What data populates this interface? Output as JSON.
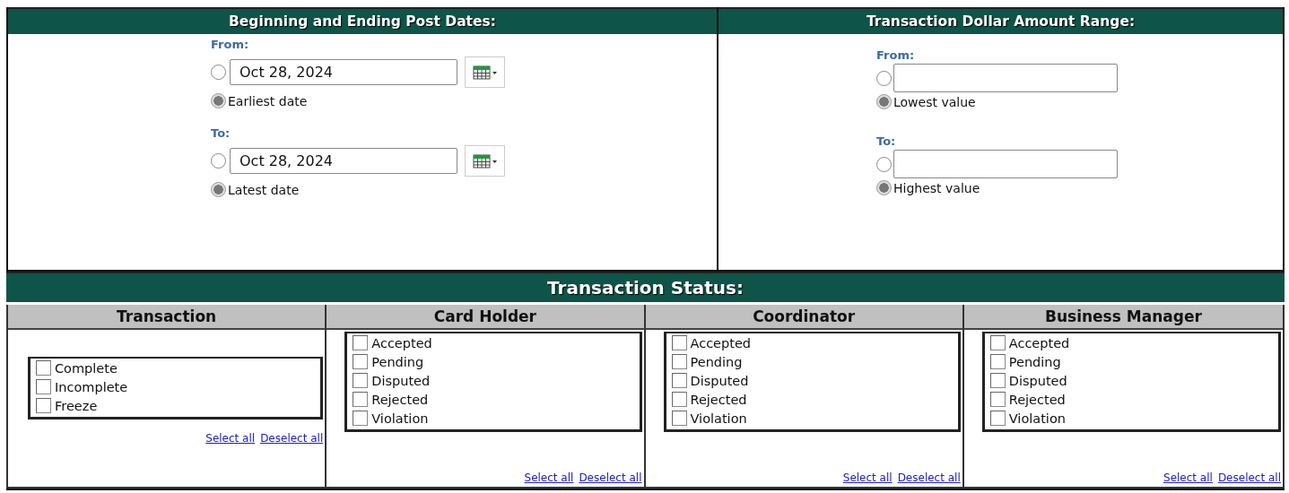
{
  "post_dates": {
    "title": "Beginning and Ending Post Dates:",
    "ranges": [
      {
        "label": "From:",
        "options": [
          {
            "kind": "date",
            "value": "Oct 28, 2024",
            "selected": false
          },
          {
            "kind": "default",
            "label": "Earliest date",
            "selected": true
          }
        ]
      },
      {
        "label": "To:",
        "options": [
          {
            "kind": "date",
            "value": "Oct 28, 2024",
            "selected": false
          },
          {
            "kind": "default",
            "label": "Latest date",
            "selected": true
          }
        ]
      }
    ]
  },
  "amount_range": {
    "title": "Transaction Dollar Amount Range:",
    "ranges": [
      {
        "label": "From:",
        "options": [
          {
            "kind": "amount",
            "selected": false
          },
          {
            "kind": "default",
            "label": "Lowest value",
            "selected": true
          }
        ]
      },
      {
        "label": "To:",
        "options": [
          {
            "kind": "amount",
            "selected": false
          },
          {
            "kind": "default",
            "label": "Highest value",
            "selected": true
          }
        ]
      }
    ]
  },
  "transaction_status": {
    "title": "Transaction Status:",
    "columns": [
      {
        "heading": "Transaction",
        "items": [
          {
            "label": "Complete",
            "checked": false
          },
          {
            "label": "Incomplete",
            "checked": false
          },
          {
            "label": "Freeze",
            "checked": false
          }
        ],
        "links": [
          "Select all",
          "Deselect all"
        ]
      },
      {
        "heading": "Card Holder",
        "items": [
          {
            "label": "Accepted",
            "checked": false
          },
          {
            "label": "Pending",
            "checked": false
          },
          {
            "label": "Disputed",
            "checked": false
          },
          {
            "label": "Rejected",
            "checked": false
          },
          {
            "label": "Violation",
            "checked": false
          }
        ],
        "links": [
          "Select all",
          "Deselect all"
        ]
      },
      {
        "heading": "Coordinator",
        "items": [
          {
            "label": "Accepted",
            "checked": false
          },
          {
            "label": "Pending",
            "checked": false
          },
          {
            "label": "Disputed",
            "checked": false
          },
          {
            "label": "Rejected",
            "checked": false
          },
          {
            "label": "Violation",
            "checked": false
          }
        ],
        "links": [
          "Select all",
          "Deselect all"
        ]
      },
      {
        "heading": "Business Manager",
        "items": [
          {
            "label": "Accepted",
            "checked": false
          },
          {
            "label": "Pending",
            "checked": false
          },
          {
            "label": "Disputed",
            "checked": false
          },
          {
            "label": "Rejected",
            "checked": false
          },
          {
            "label": "Violation",
            "checked": false
          }
        ],
        "links": [
          "Select all",
          "Deselect all"
        ]
      }
    ]
  }
}
